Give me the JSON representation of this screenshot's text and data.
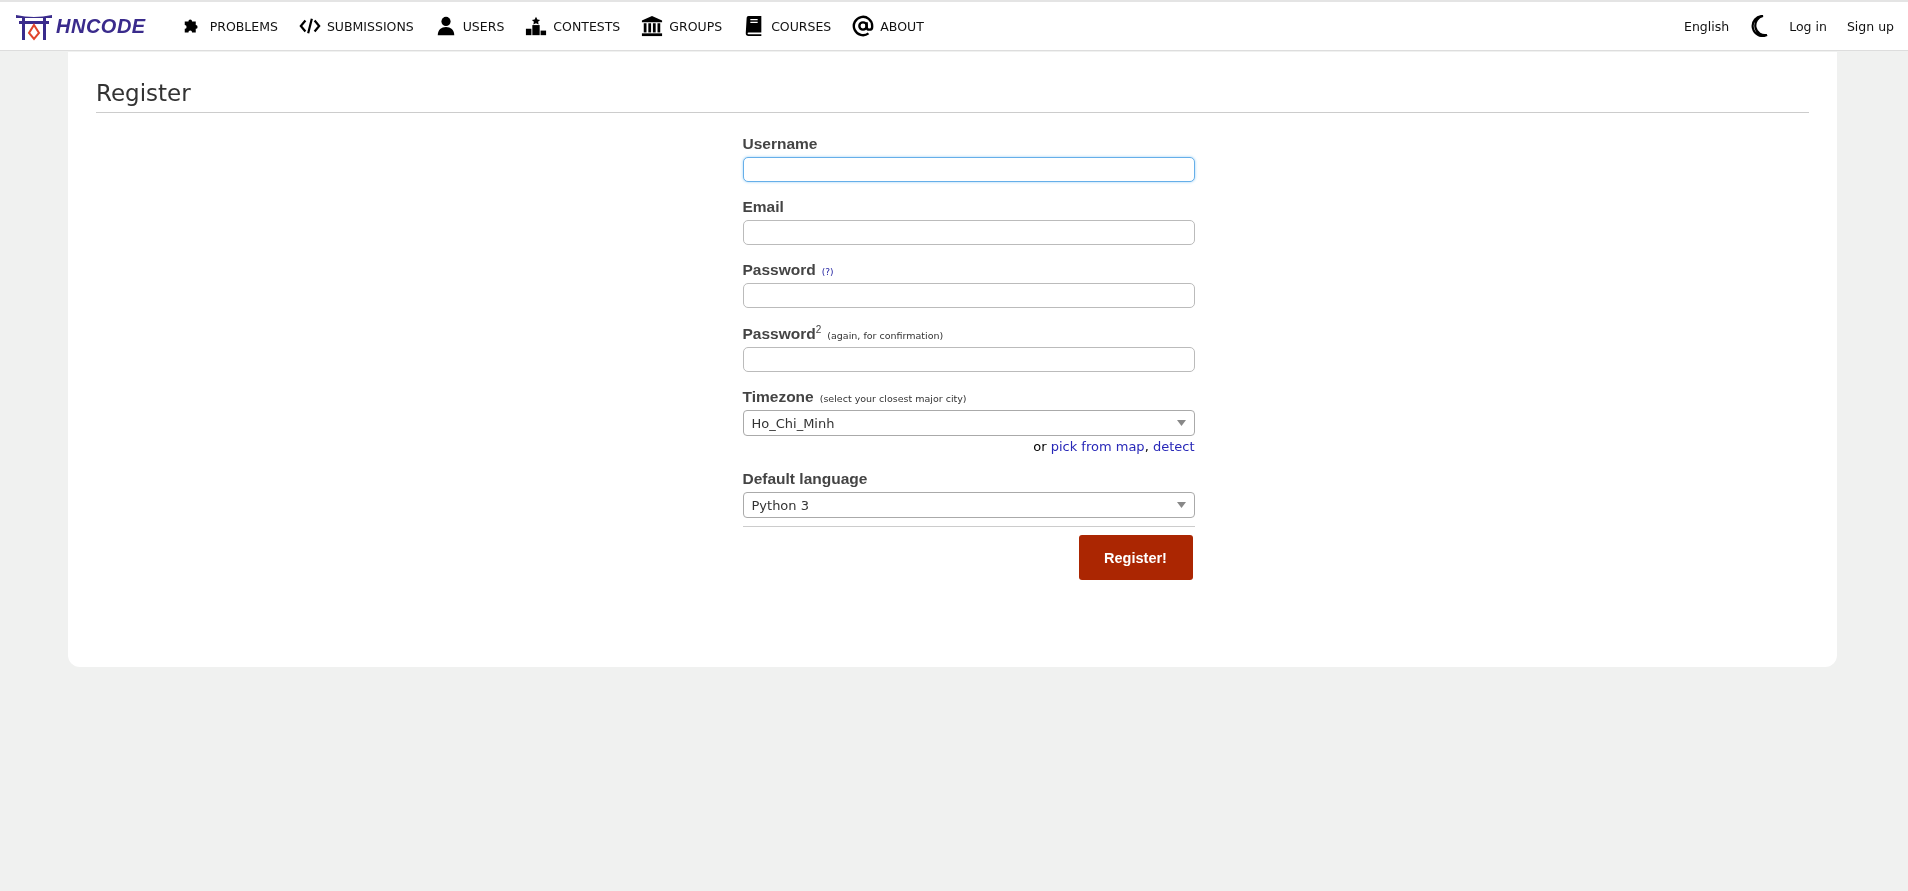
{
  "logo": {
    "text": "HNCODE"
  },
  "nav": [
    {
      "label": "PROBLEMS",
      "kind": "puzzle"
    },
    {
      "label": "SUBMISSIONS",
      "kind": "code"
    },
    {
      "label": "USERS",
      "kind": "user"
    },
    {
      "label": "CONTESTS",
      "kind": "podium"
    },
    {
      "label": "GROUPS",
      "kind": "bank"
    },
    {
      "label": "COURSES",
      "kind": "book"
    },
    {
      "label": "ABOUT",
      "kind": "at"
    }
  ],
  "nav_right": {
    "language": "English",
    "login": "Log in",
    "signup": "Sign up"
  },
  "page": {
    "title": "Register"
  },
  "form": {
    "fields": [
      {
        "kind": "text",
        "label": "Username",
        "focused": true
      },
      {
        "kind": "text",
        "label": "Email",
        "focused": false
      },
      {
        "kind": "text",
        "label": "Password",
        "help_link": "(?)",
        "focused": false
      },
      {
        "kind": "text",
        "label": "Password$^{2}$",
        "hint": "(again, for confirmation)",
        "focused": false
      },
      {
        "kind": "select",
        "label": "Timezone",
        "hint": "(select your closest major city)",
        "value": "Ho_Chi_Minh",
        "focused": false,
        "after": {
          "text": "or",
          "links": [
            "pick from map",
            "detect"
          ],
          "separator": ","
        }
      },
      {
        "kind": "select",
        "label": "Default language",
        "value": "Python 3",
        "focused": false
      }
    ],
    "submit": "Register!"
  }
}
